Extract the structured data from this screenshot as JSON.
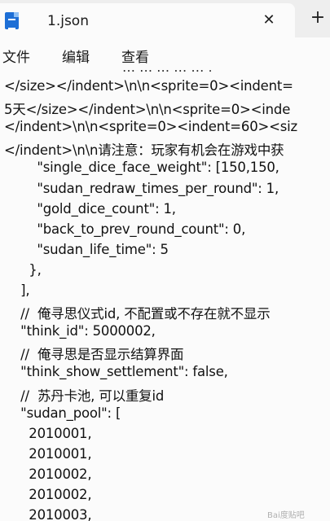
{
  "tab": {
    "title": "1.json",
    "close_glyph": "✕",
    "new_tab_glyph": "+"
  },
  "menu": {
    "file": "文件",
    "edit": "编辑",
    "view": "查看"
  },
  "editor": {
    "top_fragment": "… … … … … ,",
    "lines": [
      "</size></indent>\\n\\n<sprite=0><indent=",
      "5天</size></indent>\\n\\n<sprite=0><inde",
      "</indent>\\n\\n<sprite=0><indent=60><siz",
      "</indent>\\n\\n请注意：玩家有机会在游戏中获",
      "        \"single_dice_face_weight\": [150,150,",
      "        \"sudan_redraw_times_per_round\": 1,",
      "        \"gold_dice_count\": 1,",
      "        \"back_to_prev_round_count\": 0,",
      "        \"sudan_life_time\": 5",
      "      },",
      "    ],",
      "    //  俺寻思仪式id, 不配置或不存在就不显示",
      "    \"think_id\": 5000002,",
      "    //  俺寻思是否显示结算界面",
      "    \"think_show_settlement\": false,",
      "    //  苏丹卡池, 可以重复id",
      "    \"sudan_pool\": [",
      "      2010001,",
      "      2010001,",
      "      2010002,",
      "      2010002,",
      "      2010003,"
    ]
  },
  "watermark": "Bai度贴吧"
}
